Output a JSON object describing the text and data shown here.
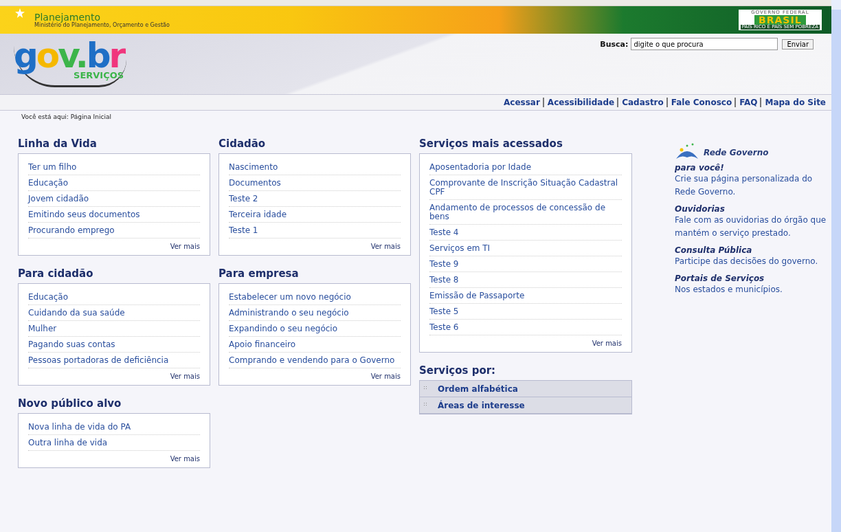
{
  "header": {
    "ministry": "Planejamento",
    "ministry_subtitle": "Ministério do Planejamento, Orçamento e Gestão",
    "brasil_logo": {
      "top": "GOVERNO FEDERAL",
      "main": "BRASIL",
      "tagline": "PAÍS RICO É PAÍS SEM POBREZA"
    },
    "logo": {
      "main": "gov.br",
      "sub": "SERVIÇOS"
    },
    "search": {
      "label": "Busca:",
      "value": "digite o que procura",
      "button": "Enviar"
    },
    "links": [
      "Acessar",
      "Acessibilidade",
      "Cadastro",
      "Fale Conosco",
      "FAQ",
      "Mapa do Site"
    ]
  },
  "breadcrumb": "Você está aqui: Página Inicial",
  "columns": [
    [
      {
        "kind": "list",
        "title": "Linha da Vida",
        "items": [
          "Ter um filho",
          "Educação",
          "Jovem cidadão",
          "Emitindo seus documentos",
          "Procurando emprego"
        ],
        "more": "Ver mais"
      },
      {
        "kind": "list",
        "title": "Para cidadão",
        "items": [
          "Educação",
          "Cuidando da sua saúde",
          "Mulher",
          "Pagando suas contas",
          "Pessoas portadoras de deficiência"
        ],
        "more": "Ver mais"
      },
      {
        "kind": "list",
        "title": "Novo público alvo",
        "items": [
          "Nova linha de vida do PA",
          "Outra linha de vida"
        ],
        "more": "Ver mais"
      }
    ],
    [
      {
        "kind": "list",
        "title": "Cidadão",
        "items": [
          "Nascimento",
          "Documentos",
          "Teste 2",
          "Terceira idade",
          "Teste 1"
        ],
        "more": "Ver mais"
      },
      {
        "kind": "list",
        "title": "Para empresa",
        "items": [
          "Estabelecer um novo negócio",
          "Administrando o seu negócio",
          "Expandindo o seu negócio",
          "Apoio financeiro",
          "Comprando e vendendo para o Governo"
        ],
        "more": "Ver mais"
      }
    ],
    [
      {
        "kind": "list",
        "title": "Serviços mais acessados",
        "items": [
          "Aposentadoria por Idade",
          "Comprovante de Inscrição Situação Cadastral CPF",
          "Andamento de processos de concessão de bens",
          "Teste 4",
          "Serviços em TI",
          "Teste 9",
          "Teste 8",
          "Emissão de Passaporte",
          "Teste 5",
          "Teste 6"
        ],
        "more": "Ver mais"
      },
      {
        "kind": "menu",
        "title": "Serviços por:",
        "items": [
          "Ordem alfabética",
          "Áreas de interesse"
        ]
      }
    ]
  ],
  "sidebar": {
    "heading": "Rede Governo",
    "entries": [
      {
        "title": "para você!",
        "text": "Crie sua página personalizada do Rede Governo."
      },
      {
        "title": "Ouvidorias",
        "text": "Fale com as ouvidorias do órgão que mantém o serviço prestado."
      },
      {
        "title": "Consulta Pública",
        "text": "Participe das decisões do governo."
      },
      {
        "title": "Portais de Serviços",
        "text": "Nos estados e municípios."
      }
    ]
  }
}
